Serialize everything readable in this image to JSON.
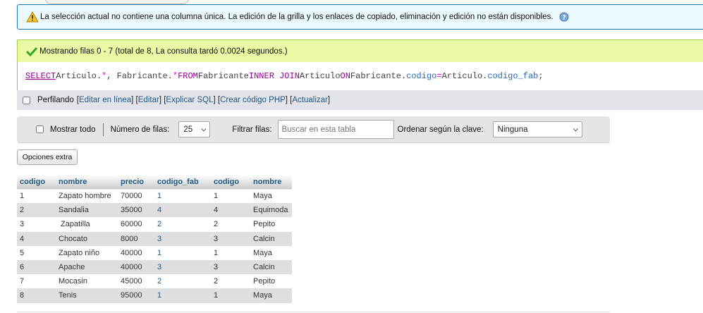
{
  "notice": {
    "text": "La selección actual no contiene una columna única. La edición de la grilla y los enlaces de copiado, eliminación y edición no están disponibles."
  },
  "success": {
    "text": "Mostrando filas 0 - 7 (total de 8, La consulta tardó 0.0024 segundos.)"
  },
  "sql": {
    "select": "SELECT",
    "t1": " Articulo.",
    "star1": "*",
    "t2": ", Fabricante.",
    "star2": "*",
    "from": " FROM",
    "t3": " Fabricante ",
    "innerjoin": "INNER JOIN",
    "t4": " Articulo ",
    "on": "ON",
    "t5": " Fabricante.",
    "codigo": "codigo",
    "eq": "=",
    "t6": "Articulo.",
    "codigo_fab": "codigo_fab",
    "semi": ";"
  },
  "profiling": {
    "label": "Perfilando",
    "links": [
      "Editar en línea",
      "Editar",
      "Explicar SQL",
      "Crear código PHP",
      "Actualizar"
    ]
  },
  "navigation": {
    "show_all": "Mostrar todo",
    "rows_label": "Número de filas:",
    "rows_value": "25",
    "filter_label": "Filtrar filas:",
    "filter_placeholder": "Buscar en esta tabla",
    "sort_label": "Ordenar según la clave:",
    "sort_value": "Ninguna"
  },
  "extra_options": "Opciones extra",
  "table": {
    "headers": [
      "codigo",
      "nombre",
      "precio",
      "codigo_fab",
      "codigo",
      "nombre"
    ],
    "rows": [
      [
        "1",
        "Zapato hombre",
        "70000",
        "1",
        "1",
        "Maya"
      ],
      [
        "2",
        "Sandalia",
        "35000",
        "4",
        "4",
        "Equimoda"
      ],
      [
        "3",
        " Zapatilla",
        "60000",
        "2",
        "2",
        "Pepito"
      ],
      [
        "4",
        "Chocato",
        "8000",
        "3",
        "3",
        "Calcin"
      ],
      [
        "5",
        "Zapato niño",
        "40000",
        "1",
        "1",
        "Maya"
      ],
      [
        "6",
        "Apache",
        "40000",
        "3",
        "3",
        "Calcin"
      ],
      [
        "7",
        "Mocasin",
        "45000",
        "2",
        "2",
        "Pepito"
      ],
      [
        "8",
        "Tenis",
        "95000",
        "1",
        "1",
        "Maya"
      ]
    ]
  },
  "colors": {
    "notice_bg": "#ebf8fd",
    "success_bg": "#ebf8a4",
    "link": "#235a81",
    "sql_keyword": "#990099"
  }
}
